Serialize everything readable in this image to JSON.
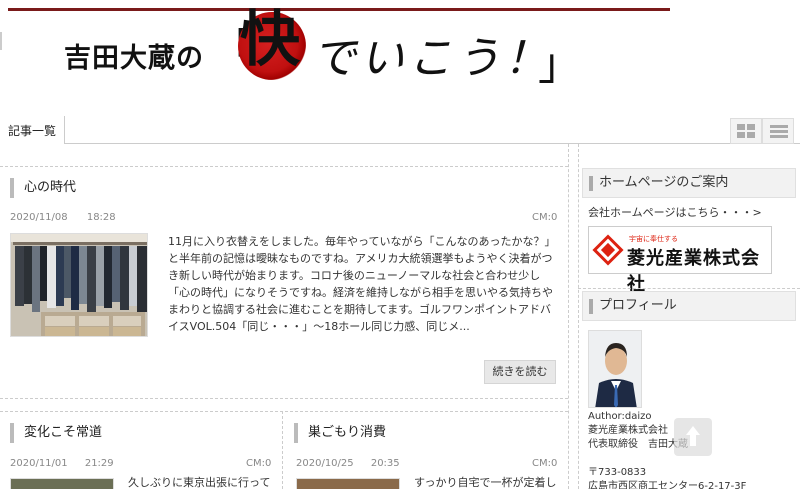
{
  "header": {
    "title": "吉田大蔵の",
    "bracket_open": "「",
    "kai": "快",
    "slogan": "でいこう！",
    "bracket_close": "」"
  },
  "tabs": {
    "articles_label": "記事一覧",
    "grid_icon": "grid-view-icon",
    "list_icon": "list-view-icon"
  },
  "posts": [
    {
      "title": "心の時代",
      "date": "2020/11/08",
      "time": "18:28",
      "cm": "CM:0",
      "lines": [
        "11月に入り衣替えをしました。毎年やっていながら「こんなのあったかな？」",
        "と半年前の記憶は曖昧なものですね。アメリカ大統領選挙もようやく決着がつ",
        "き新しい時代が始まります。コロナ後のニューノーマルな社会と合わせ少し",
        "「心の時代」になりそうですね。経済を維持しながら相手を思いやる気持ちや",
        "まわりと協調する社会に進むことを期待してます。ゴルフワンポイントアドバ",
        "イスVOL.504「同じ・・・」〜18ホール同じ力感、同じメ..."
      ],
      "more_label": "続きを読む"
    },
    {
      "title": "変化こそ常道",
      "date": "2020/11/01",
      "time": "21:29",
      "cm": "CM:0",
      "snippet": "久しぶりに東京出張に行って"
    },
    {
      "title": "巣ごもり消費",
      "date": "2020/10/25",
      "time": "20:35",
      "cm": "CM:0",
      "snippet": "すっかり自宅で一杯が定着し"
    }
  ],
  "sidebar": {
    "homepage": {
      "heading": "ホームページのご案内",
      "link_text": "会社ホームページはこちら・・・>",
      "logo_small": "宇宙に奉仕する",
      "logo_name": "菱光産業株式会社"
    },
    "profile": {
      "heading": "プロフィール",
      "author": "Author:daizo",
      "company": "菱光産業株式会社",
      "role": "代表取締役　吉田大蔵",
      "postal": "〒733-0833",
      "address": "広島市西区商工センター6-2-17-3F"
    }
  },
  "colors": {
    "banner_line": "#7a1a1a",
    "seal_red": "#c01010",
    "logo_red": "#dd2211"
  }
}
